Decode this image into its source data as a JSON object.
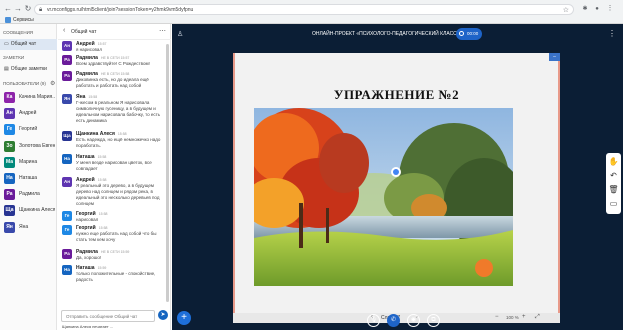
{
  "browser": {
    "url": "vr.mconfiggs.ru/html5client/join?sessionToken=y2hmk9vm5dyfpnu",
    "bookmark_label": "Сервисы",
    "icons": [
      "back-icon",
      "forward-icon",
      "reload-icon",
      "home-icon",
      "lock-icon",
      "star-icon",
      "extension-icon",
      "profile-icon",
      "menu-icon"
    ]
  },
  "sidebar": {
    "messages_header": "СООБЩЕНИЯ",
    "public_chat": "Общий чат",
    "notes_header": "ЗАМЕТКИ",
    "shared_notes": "Общие заметки",
    "users_header": "ПОЛЬЗОВАТЕЛИ (9)",
    "users": [
      {
        "initials": "Ка",
        "name": "Качина Мария...",
        "color": "#8e24aa"
      },
      {
        "initials": "Ан",
        "name": "Андрей",
        "color": "#5e35b1"
      },
      {
        "initials": "Ге",
        "name": "Георгий",
        "color": "#1e88e5"
      },
      {
        "initials": "Зо",
        "name": "Золотова Евгени...",
        "color": "#2e7d32"
      },
      {
        "initials": "Ма",
        "name": "Марина",
        "color": "#00897b"
      },
      {
        "initials": "На",
        "name": "Наташа",
        "color": "#1565c0"
      },
      {
        "initials": "Ра",
        "name": "Радмила",
        "color": "#6a1b9a"
      },
      {
        "initials": "Ща",
        "name": "Щанкина Алеся",
        "color": "#283593"
      },
      {
        "initials": "Ян",
        "name": "Яна",
        "color": "#3949ab"
      }
    ]
  },
  "chat": {
    "title": "Общий чат",
    "messages": [
      {
        "initials": "Ан",
        "color": "#5e35b1",
        "name": "Андрей",
        "time": "15:57",
        "text": "я нарисовал"
      },
      {
        "initials": "Ра",
        "color": "#6a1b9a",
        "name": "Радмила",
        "time": "НЕ В СЕТИ  15:57",
        "text": "Всем здравствуйте! С Рождеством!"
      },
      {
        "initials": "Ра",
        "color": "#6a1b9a",
        "name": "Радмила",
        "time": "НЕ В СЕТИ  15:58",
        "text": "Диковинка есть, но до идеала ещё работать и работать над собой"
      },
      {
        "initials": "Ян",
        "color": "#3949ab",
        "name": "Яна",
        "time": "15:58",
        "text": "Г-жесом в реальном Я нарисовала символичную гусеницу, а в будущем и идеальном нарисовала бабочку, то есть есть динамика"
      },
      {
        "initials": "Ща",
        "color": "#283593",
        "name": "Щанкина Алеся",
        "time": "15:58",
        "text": "Есть надежда, но ещё немножечко надо поработать."
      },
      {
        "initials": "На",
        "color": "#1565c0",
        "name": "Наташа",
        "time": "15:58",
        "text": "У меня везде нарисован цветок, все совпадает"
      },
      {
        "initials": "Ан",
        "color": "#5e35b1",
        "name": "Андрей",
        "time": "15:58",
        "text": "Я реальный это дерево, а в будущем дерево над солнцем и рядом река, в идеальный это несколько деревьев под солнцем"
      },
      {
        "initials": "Ге",
        "color": "#1e88e5",
        "name": "Георгий",
        "time": "15:58",
        "text": "нарисовал"
      },
      {
        "initials": "Ге",
        "color": "#1e88e5",
        "name": "Георгий",
        "time": "15:58",
        "text": "нужно еще работать над собой что бы стать тем кем хочу"
      },
      {
        "initials": "Ра",
        "color": "#6a1b9a",
        "name": "Радмила",
        "time": "НЕ В СЕТИ  15:59",
        "text": "Да, хорошо!"
      },
      {
        "initials": "На",
        "color": "#1565c0",
        "name": "Наташа",
        "time": "15:59",
        "text": "только положительные - спокойствие, радость"
      }
    ],
    "input_placeholder": "Отправить сообщение Общий чат",
    "typing": "Щанкина Алеся печатает ..."
  },
  "main": {
    "session_title": "ОНЛАЙН-ПРОЕКТ «ПСИХОЛОГО-ПЕДАГОГИЧЕСКИЙ КЛАСС»",
    "record_label": "00:00",
    "slide_title": "УПРАЖНЕНИЕ №2",
    "slide_label": "Слайд 7",
    "zoom_value": "100 %",
    "tools": [
      "hand-icon",
      "undo-icon",
      "trash-icon",
      "whiteboard-icon"
    ],
    "bottom_buttons": [
      "mic-icon",
      "phone-icon",
      "camera-icon",
      "screenshare-icon"
    ]
  },
  "colors": {
    "accent": "#1e64c8",
    "panel_bg": "#0b1e35",
    "orange_dot": "#f07a2a"
  }
}
